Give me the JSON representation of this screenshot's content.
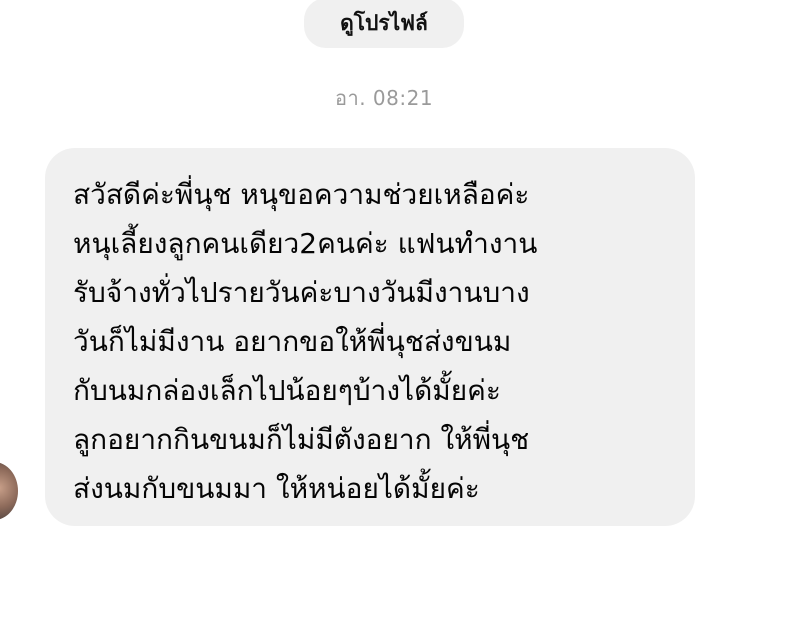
{
  "header": {
    "view_profile_label": "ดูโปรไฟล์"
  },
  "timestamp": "อา. 08:21",
  "message": {
    "lines": [
      "สวัสดีค่ะพี่นุช หนุขอความช่วยเหลือค่ะ",
      "หนุเลี้ยงลูกคนเดียว2คนค่ะ แฟนทำงาน",
      "รับจ้างทั่วไปรายวันค่ะบางวันมีงานบาง",
      "วันก็ไม่มีงาน อยากขอให้พี่นุชส่งขนม",
      "กับนมกล่องเล็กไปน้อยๆบ้างได้มั้ยค่ะ",
      "ลูกอยากกินขนมก็ไม่มีตังอยาก ให้พี่นุช",
      "ส่งนมกับขนมมา ให้หน่อยได้มั้ยค่ะ"
    ]
  },
  "colors": {
    "bubble_bg": "#f0f0f0",
    "text": "#050505",
    "timestamp": "#9a9a9a"
  }
}
